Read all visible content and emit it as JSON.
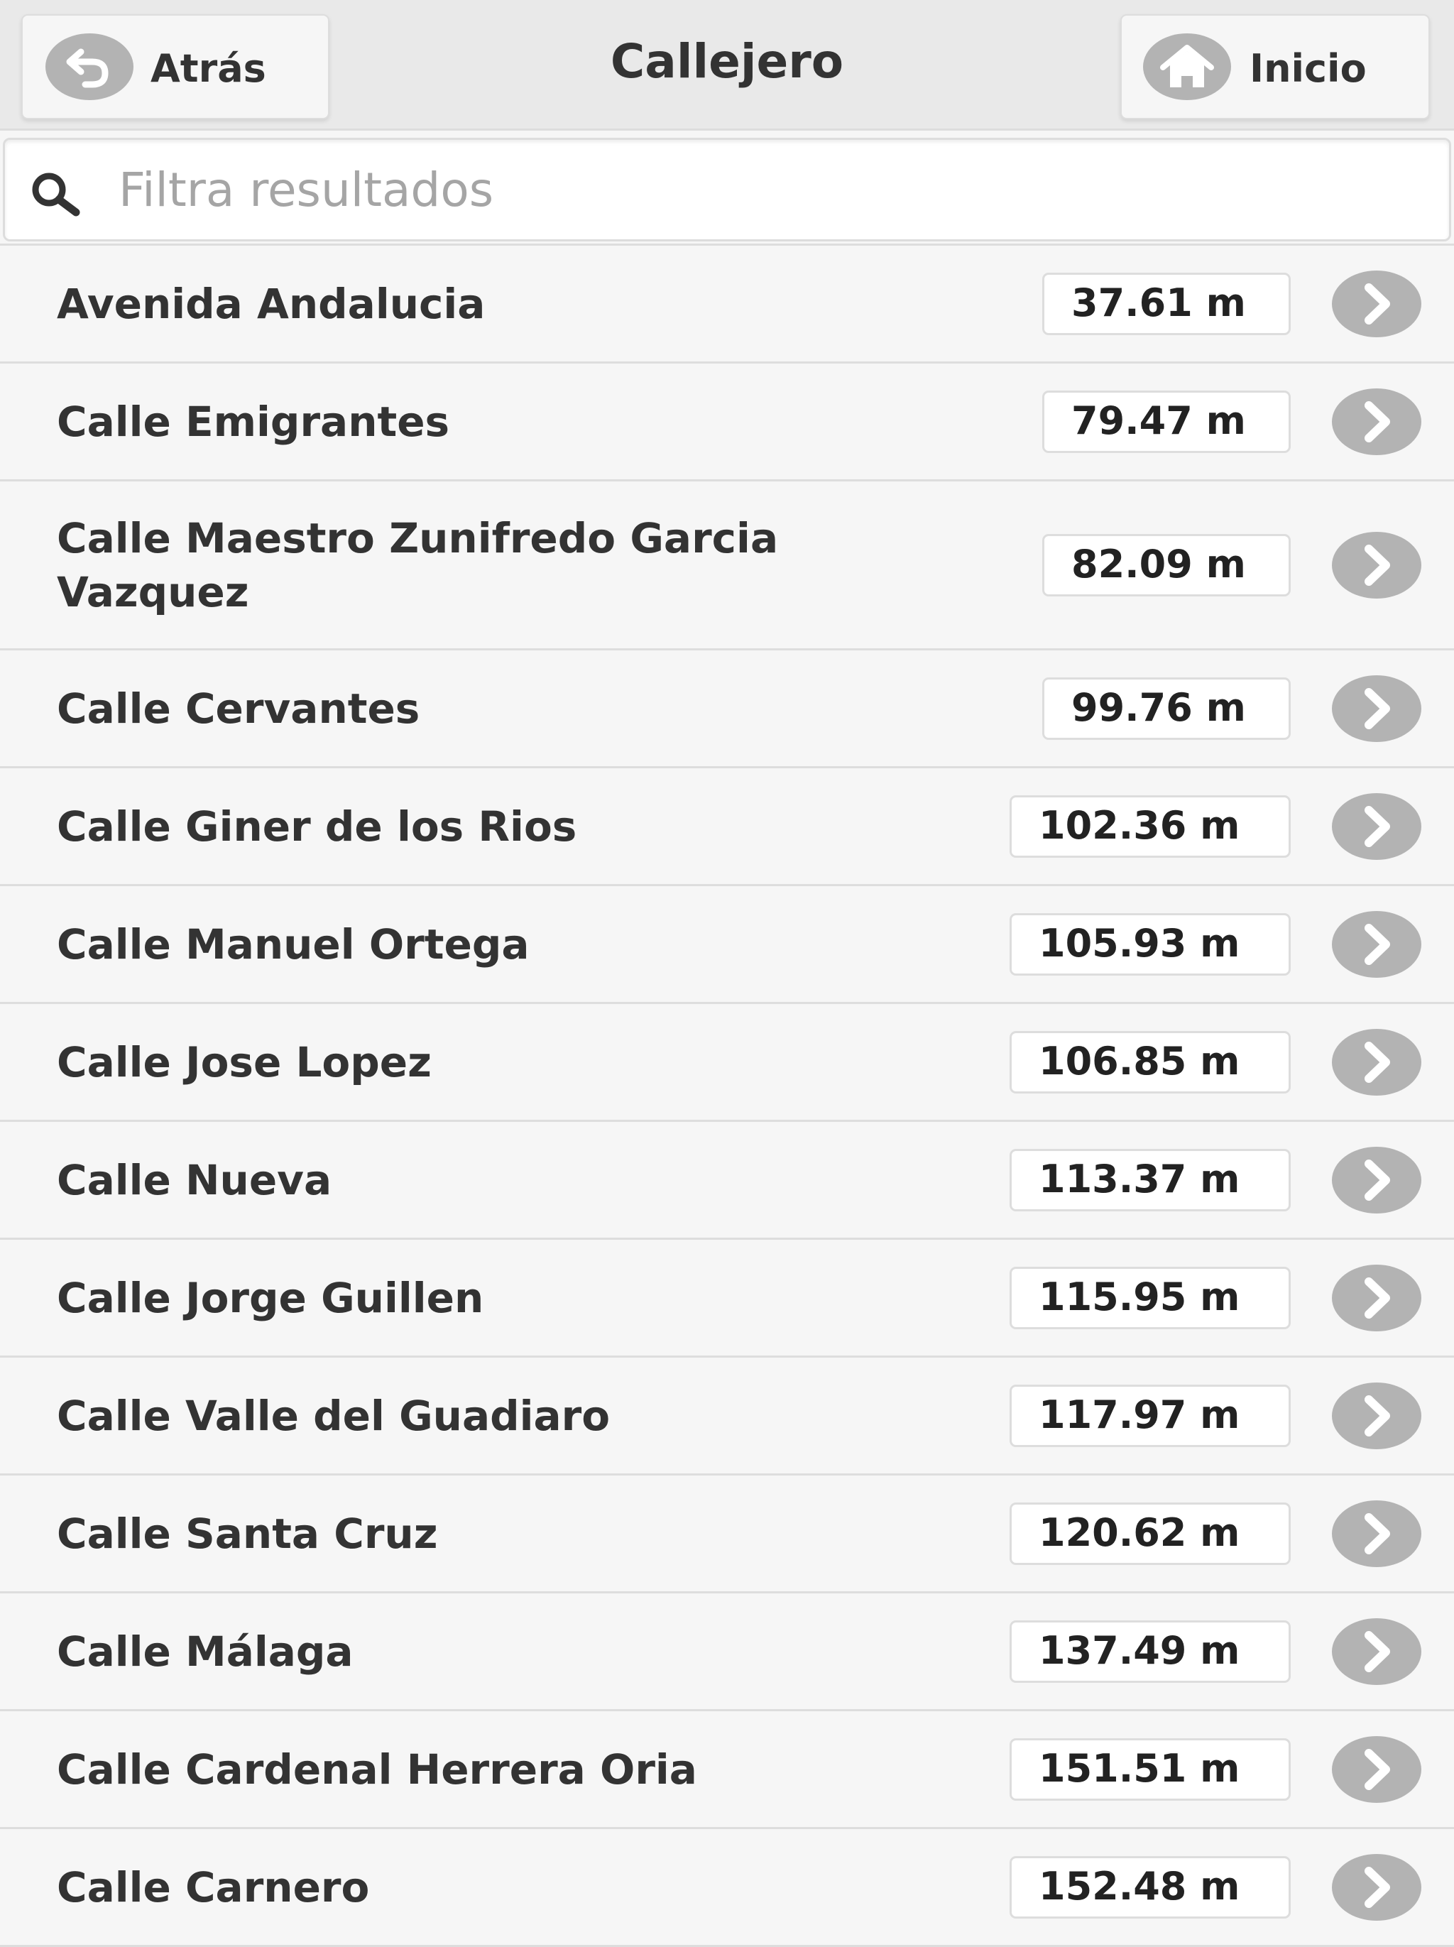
{
  "header": {
    "title": "Callejero",
    "back_label": "Atrás",
    "home_label": "Inicio"
  },
  "search": {
    "placeholder": "Filtra resultados",
    "value": ""
  },
  "colors": {
    "icon_gray": "#b3b3b3",
    "header_bg": "#e9e9e9",
    "list_bg": "#f6f6f6",
    "border": "#dddddd"
  },
  "icons": {
    "back": "back-arrow-icon",
    "home": "home-icon",
    "search": "search-icon",
    "row_arrow": "chevron-right-icon"
  },
  "streets": [
    {
      "name": "Avenida Andalucia",
      "distance": "37.61 m"
    },
    {
      "name": "Calle Emigrantes",
      "distance": "79.47 m"
    },
    {
      "name": "Calle Maestro Zunifredo Garcia Vazquez",
      "distance": "82.09 m"
    },
    {
      "name": "Calle Cervantes",
      "distance": "99.76 m"
    },
    {
      "name": "Calle Giner de los Rios",
      "distance": "102.36 m"
    },
    {
      "name": "Calle Manuel Ortega",
      "distance": "105.93 m"
    },
    {
      "name": "Calle Jose Lopez",
      "distance": "106.85 m"
    },
    {
      "name": "Calle Nueva",
      "distance": "113.37 m"
    },
    {
      "name": "Calle Jorge Guillen",
      "distance": "115.95 m"
    },
    {
      "name": "Calle Valle del Guadiaro",
      "distance": "117.97 m"
    },
    {
      "name": "Calle Santa Cruz",
      "distance": "120.62 m"
    },
    {
      "name": "Calle Málaga",
      "distance": "137.49 m"
    },
    {
      "name": "Calle Cardenal Herrera Oria",
      "distance": "151.51 m"
    },
    {
      "name": "Calle Carnero",
      "distance": "152.48 m"
    }
  ]
}
